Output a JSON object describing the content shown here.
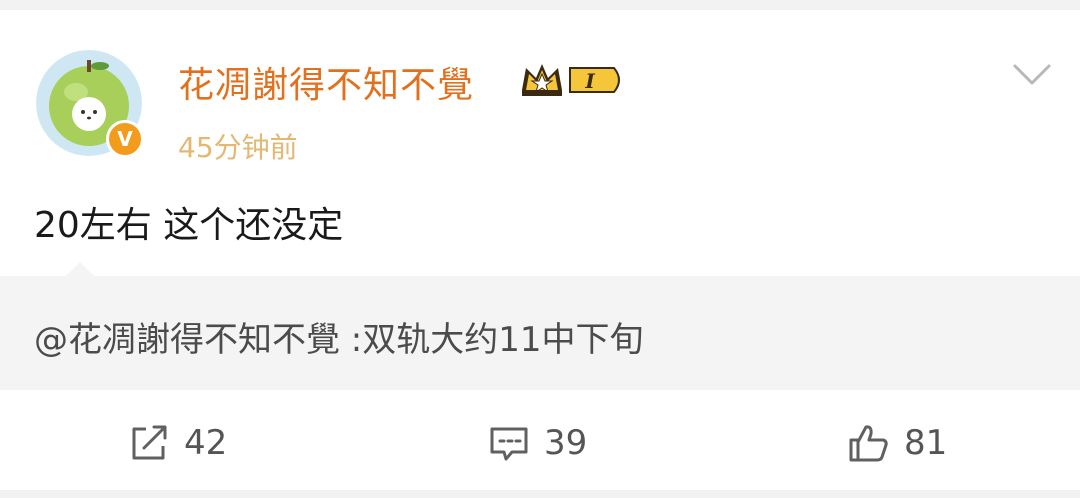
{
  "post": {
    "author": "花凋謝得不知不覺",
    "badge_level": "I",
    "time": "45分钟前",
    "content": "20左右 这个还没定"
  },
  "quote": {
    "text": "@花凋謝得不知不覺 :双轨大约11中下旬"
  },
  "actions": {
    "repost_count": "42",
    "comment_count": "39",
    "like_count": "81"
  },
  "colors": {
    "username": "#e2701c",
    "timestamp": "#e3b873",
    "verified_badge": "#f39b1c",
    "quote_background": "#f4f4f4"
  },
  "icons": [
    "avatar-apple-cat",
    "verified-v-icon",
    "crown-level-badge-icon",
    "chevron-down-icon",
    "repost-icon",
    "comment-icon",
    "like-icon"
  ]
}
